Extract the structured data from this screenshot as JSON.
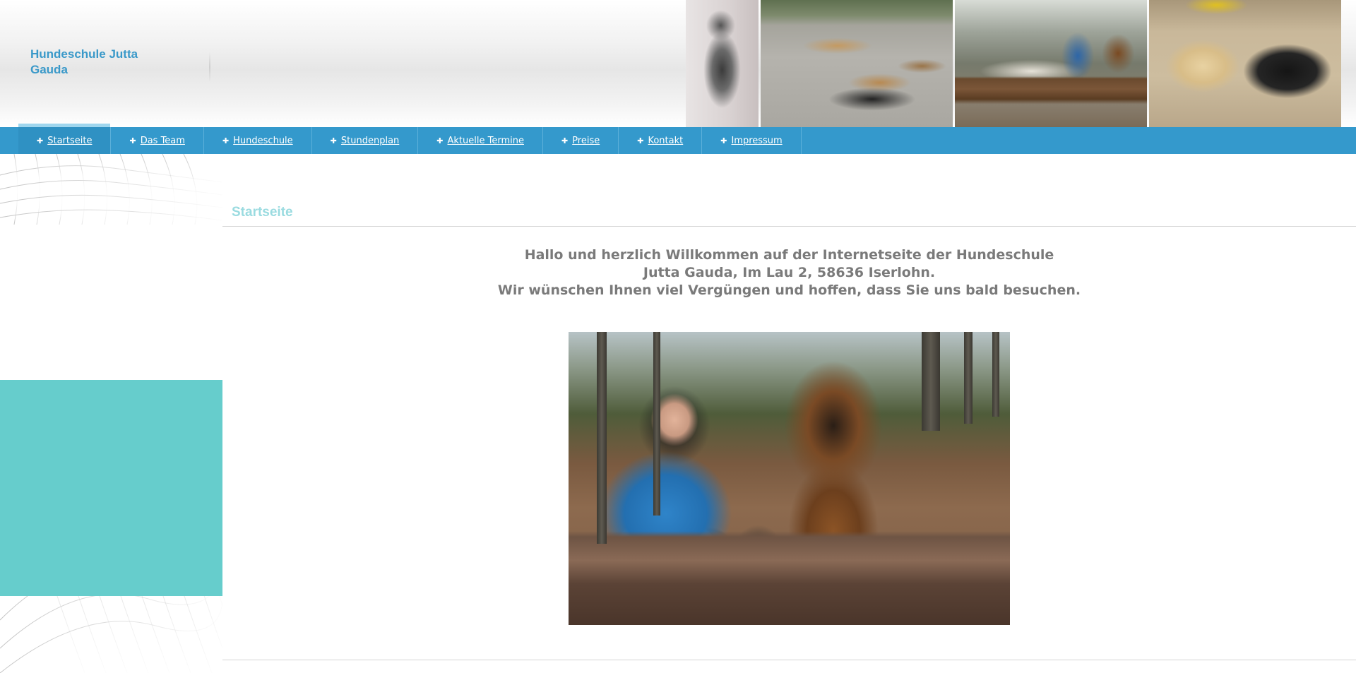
{
  "site": {
    "title": "Hundeschule Jutta Gauda"
  },
  "header": {
    "photos": [
      "wolf-drawing",
      "dogs-on-path",
      "group-on-bench",
      "labradors"
    ]
  },
  "nav": {
    "items": [
      {
        "label": "Startseite",
        "active": true
      },
      {
        "label": "Das Team",
        "active": false
      },
      {
        "label": "Hundeschule",
        "active": false
      },
      {
        "label": "Stundenplan",
        "active": false
      },
      {
        "label": "Aktuelle Termine",
        "active": false
      },
      {
        "label": "Preise",
        "active": false
      },
      {
        "label": "Kontakt",
        "active": false
      },
      {
        "label": "Impressum",
        "active": false
      }
    ]
  },
  "main": {
    "heading": "Startseite",
    "welcome_lines": [
      "Hallo und herzlich Willkommen auf der Internetseite der Hundeschule",
      "Jutta Gauda, Im Lau 2, 58636 Iserlohn.",
      "Wir wünschen Ihnen viel Vergüngen und hoffen, dass Sie uns bald besuchen."
    ]
  },
  "colors": {
    "nav_bar": "#3499cc",
    "title": "#3a99c9",
    "heading": "#9adbe0",
    "teal_block": "#66cdcc",
    "welcome_text": "#7a7a7a"
  }
}
